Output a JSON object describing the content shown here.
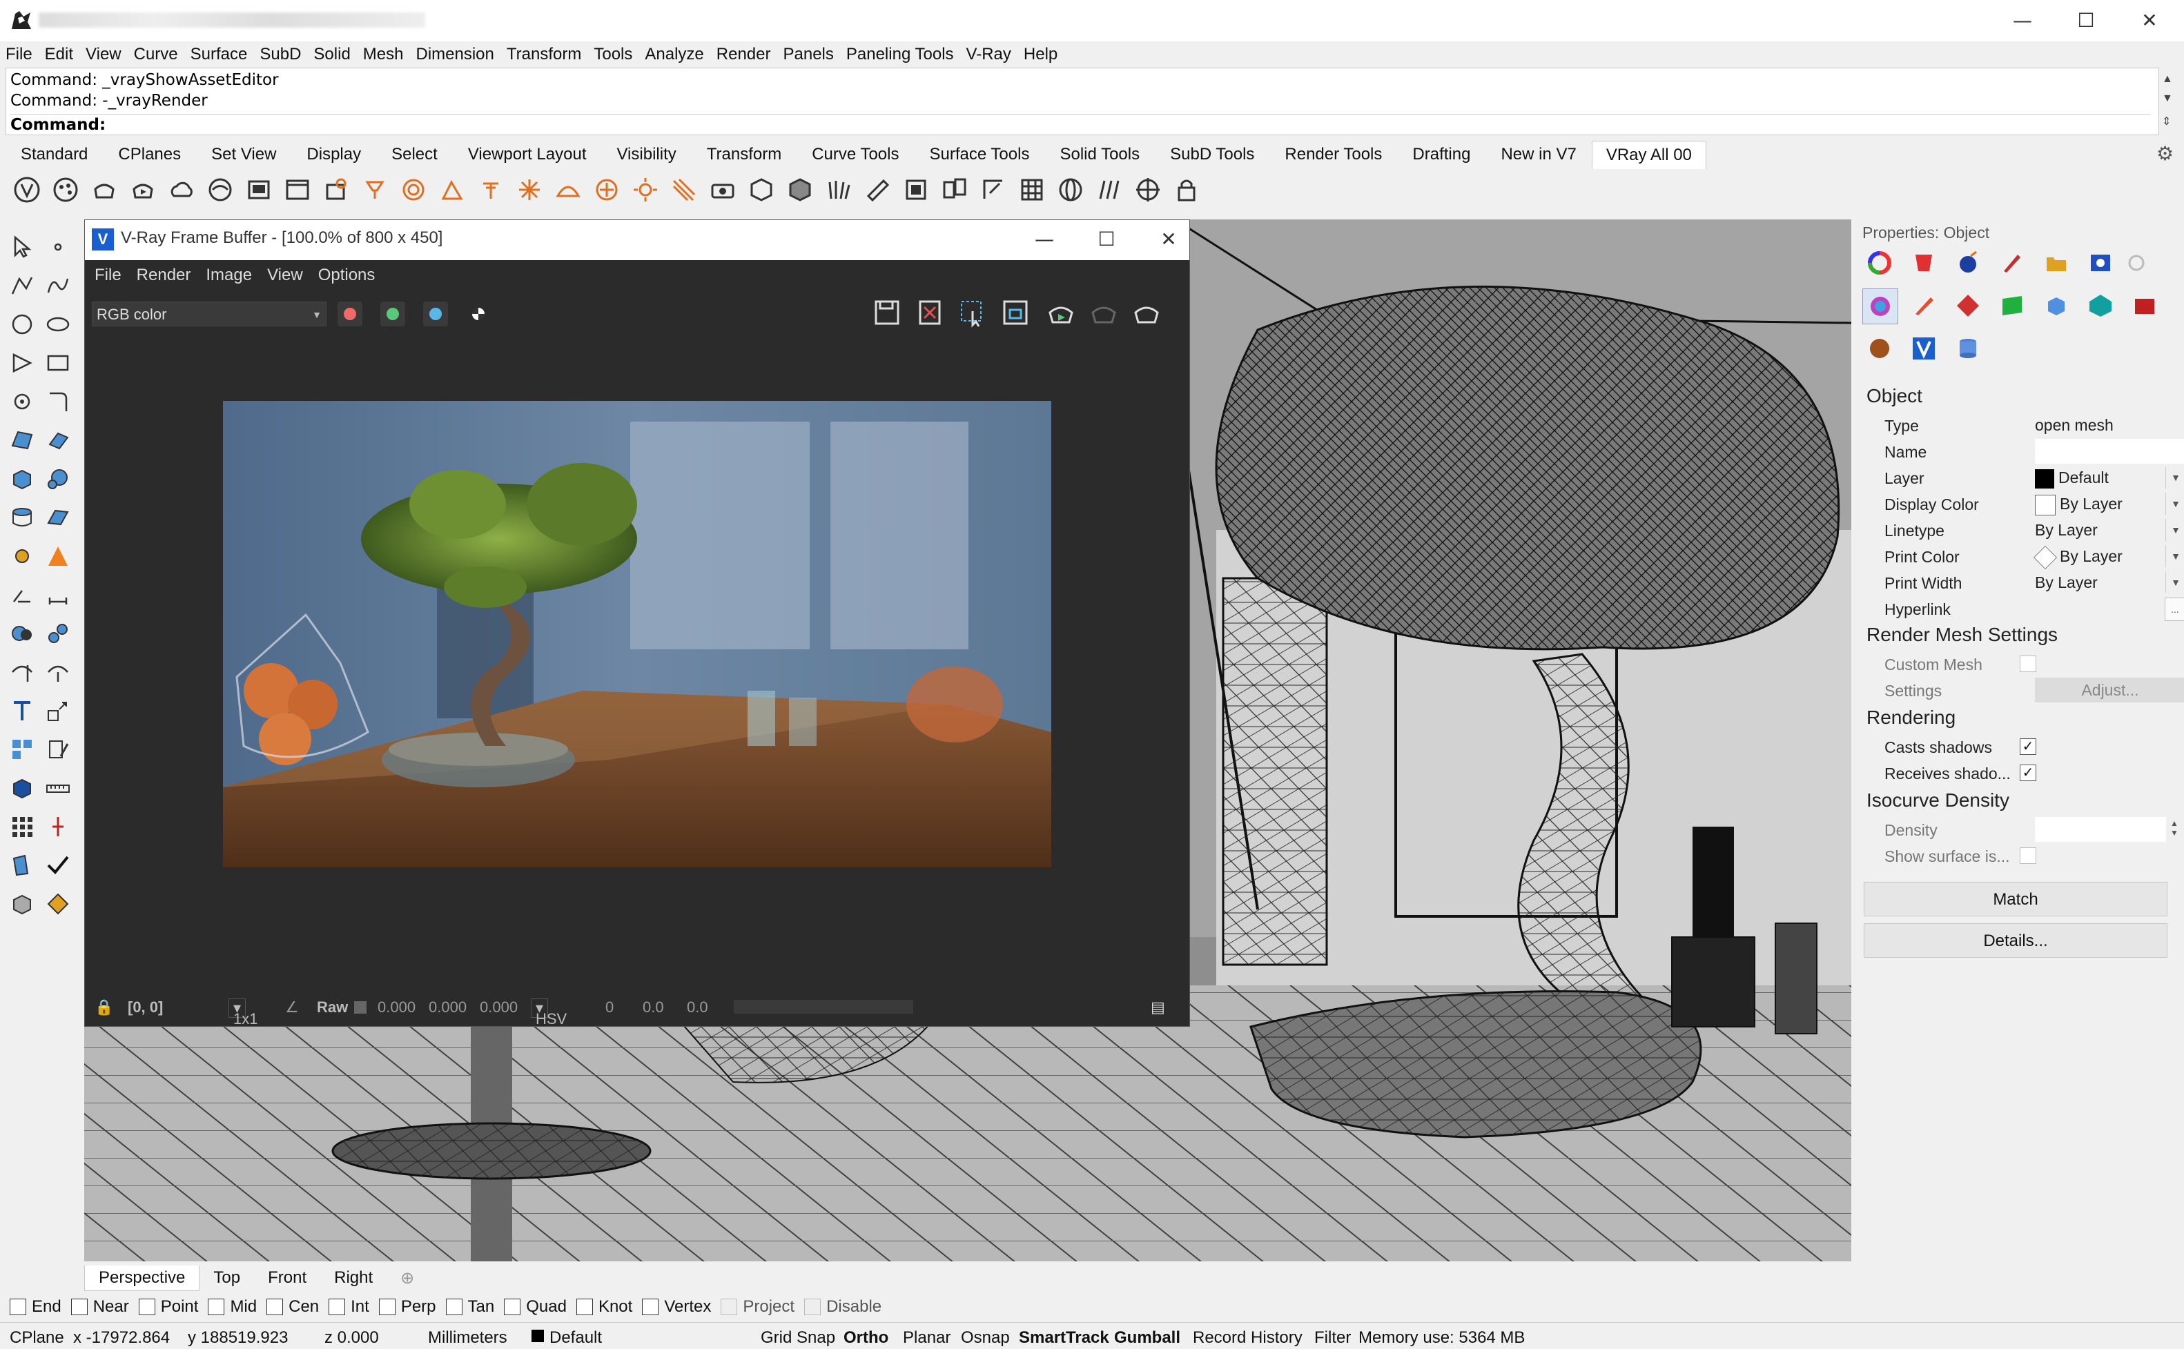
{
  "window": {
    "minimize": "—",
    "maximize": "☐",
    "close": "✕"
  },
  "menu": [
    "File",
    "Edit",
    "View",
    "Curve",
    "Surface",
    "SubD",
    "Solid",
    "Mesh",
    "Dimension",
    "Transform",
    "Tools",
    "Analyze",
    "Render",
    "Panels",
    "Paneling Tools",
    "V-Ray",
    "Help"
  ],
  "command": {
    "history": [
      "Command: _vrayShowAssetEditor",
      "Command: -_vrayRender"
    ],
    "prompt": "Command:"
  },
  "toolbar_tabs": [
    "Standard",
    "CPlanes",
    "Set View",
    "Display",
    "Select",
    "Viewport Layout",
    "Visibility",
    "Transform",
    "Curve Tools",
    "Surface Tools",
    "Solid Tools",
    "SubD Tools",
    "Render Tools",
    "Drafting",
    "New in V7",
    "VRay All 00"
  ],
  "active_tab": "VRay All 00",
  "vfb": {
    "title": "V-Ray Frame Buffer - [100.0% of 800 x 450]",
    "logo": "V",
    "menu": [
      "File",
      "Render",
      "Image",
      "View",
      "Options"
    ],
    "channel": "RGB color",
    "channel_colors": [
      "#f06a6a",
      "#59c979",
      "#5ab8e8"
    ],
    "status": {
      "coords": "[0, 0]",
      "ratio": "1x1",
      "raw_label": "Raw",
      "rgb": [
        "0.000",
        "0.000",
        "0.000"
      ],
      "mode": "HSV",
      "hsv": [
        "0",
        "0.0",
        "0.0"
      ]
    }
  },
  "viewport_tabs": [
    "Perspective",
    "Top",
    "Front",
    "Right"
  ],
  "viewport_add": "⊕",
  "properties": {
    "title": "Properties: Object",
    "sections": {
      "object": "Object",
      "render_mesh": "Render Mesh Settings",
      "rendering": "Rendering",
      "isocurve": "Isocurve Density"
    },
    "object_rows": [
      {
        "label": "Type",
        "value": "open mesh"
      },
      {
        "label": "Name",
        "value": ""
      },
      {
        "label": "Layer",
        "value": "Default"
      },
      {
        "label": "Display Color",
        "value": "By Layer"
      },
      {
        "label": "Linetype",
        "value": "By Layer"
      },
      {
        "label": "Print Color",
        "value": "By Layer"
      },
      {
        "label": "Print Width",
        "value": "By Layer"
      },
      {
        "label": "Hyperlink",
        "value": "..."
      }
    ],
    "custom_mesh": "Custom Mesh",
    "settings": "Settings",
    "adjust": "Adjust...",
    "casts_shadows": "Casts shadows",
    "receives_shadows": "Receives shado...",
    "density": "Density",
    "show_surface": "Show surface is...",
    "match": "Match",
    "details": "Details..."
  },
  "osnaps": [
    {
      "label": "End",
      "enabled": true
    },
    {
      "label": "Near",
      "enabled": true
    },
    {
      "label": "Point",
      "enabled": true
    },
    {
      "label": "Mid",
      "enabled": true
    },
    {
      "label": "Cen",
      "enabled": true
    },
    {
      "label": "Int",
      "enabled": true
    },
    {
      "label": "Perp",
      "enabled": true
    },
    {
      "label": "Tan",
      "enabled": true
    },
    {
      "label": "Quad",
      "enabled": true
    },
    {
      "label": "Knot",
      "enabled": true
    },
    {
      "label": "Vertex",
      "enabled": true
    },
    {
      "label": "Project",
      "enabled": false
    },
    {
      "label": "Disable",
      "enabled": false
    }
  ],
  "status": {
    "cplane": "CPlane",
    "x": "x -17972.864",
    "y": "y 188519.923",
    "z": "z 0.000",
    "units": "Millimeters",
    "layer": "Default",
    "grid_snap": "Grid Snap",
    "ortho": "Ortho",
    "planar": "Planar",
    "osnap": "Osnap",
    "smarttrack": "SmartTrack",
    "gumball": "Gumball",
    "record_history": "Record History",
    "filter": "Filter",
    "memory": "Memory use: 5364 MB"
  }
}
